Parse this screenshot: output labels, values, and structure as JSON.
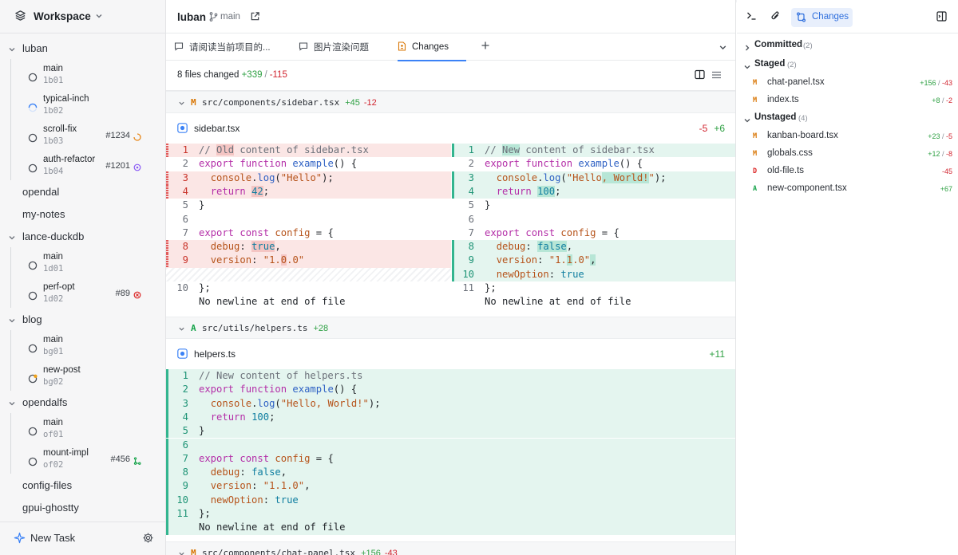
{
  "workspace": {
    "title": "Workspace"
  },
  "sidebar": {
    "projects": [
      {
        "name": "luban",
        "expanded": true,
        "branches": [
          {
            "name": "main",
            "id": "1b01",
            "pr": "",
            "status": "circle"
          },
          {
            "name": "typical-inch",
            "id": "1b02",
            "pr": "",
            "status": "spinner"
          },
          {
            "name": "scroll-fix",
            "id": "1b03",
            "pr": "#1234",
            "status": "circle",
            "pr_status": "pending"
          },
          {
            "name": "auth-refactor",
            "id": "1b04",
            "pr": "#1201",
            "status": "circle",
            "pr_status": "open"
          }
        ]
      },
      {
        "name": "opendal",
        "expanded": false,
        "branches": []
      },
      {
        "name": "my-notes",
        "expanded": false,
        "branches": []
      },
      {
        "name": "lance-duckdb",
        "expanded": true,
        "branches": [
          {
            "name": "main",
            "id": "1d01",
            "pr": "",
            "status": "circle"
          },
          {
            "name": "perf-opt",
            "id": "1d02",
            "pr": "#89",
            "status": "circle",
            "pr_status": "failed"
          }
        ]
      },
      {
        "name": "blog",
        "expanded": true,
        "branches": [
          {
            "name": "main",
            "id": "bg01",
            "pr": "",
            "status": "circle"
          },
          {
            "name": "new-post",
            "id": "bg02",
            "pr": "",
            "status": "draft"
          }
        ]
      },
      {
        "name": "opendalfs",
        "expanded": true,
        "branches": [
          {
            "name": "main",
            "id": "of01",
            "pr": "",
            "status": "circle"
          },
          {
            "name": "mount-impl",
            "id": "of02",
            "pr": "#456",
            "status": "circle",
            "pr_status": "merged"
          }
        ]
      },
      {
        "name": "config-files",
        "expanded": false,
        "branches": []
      },
      {
        "name": "gpui-ghostty",
        "expanded": false,
        "branches": []
      }
    ],
    "footer": {
      "new_task": "New Task"
    }
  },
  "main": {
    "repo": "luban",
    "branch": "main",
    "tabs": [
      {
        "label": "请阅读当前项目的...",
        "icon": "chat-icon",
        "active": false
      },
      {
        "label": "图片渲染问题",
        "icon": "chat-icon",
        "active": false
      },
      {
        "label": "Changes",
        "icon": "file-diff-icon",
        "active": true
      }
    ],
    "summary": {
      "text": "8 files changed",
      "additions": "+339",
      "separator": "/",
      "deletions": "-115"
    },
    "files": [
      {
        "status": "M",
        "path": "src/components/sidebar.tsx",
        "additions": "+45",
        "deletions": "-12",
        "name": "sidebar.tsx",
        "num_del": "-5",
        "num_add": "+6",
        "footer": "No newline at end of file"
      },
      {
        "status": "A",
        "path": "src/utils/helpers.ts",
        "additions": "+28",
        "deletions": "",
        "name": "helpers.ts",
        "num_del": "",
        "num_add": "+11",
        "footer": "No newline at end of file"
      },
      {
        "status": "M",
        "path": "src/components/chat-panel.tsx",
        "additions": "+156",
        "deletions": "-43"
      }
    ]
  },
  "right": {
    "changes_label": "Changes",
    "sections": [
      {
        "title": "Committed",
        "count": "(2)",
        "expanded": false,
        "items": []
      },
      {
        "title": "Staged",
        "count": "(2)",
        "expanded": true,
        "items": [
          {
            "status": "M",
            "file": "chat-panel.tsx",
            "additions": "+156",
            "deletions": "-43"
          },
          {
            "status": "M",
            "file": "index.ts",
            "additions": "+8",
            "deletions": "-2"
          }
        ]
      },
      {
        "title": "Unstaged",
        "count": "(4)",
        "expanded": true,
        "items": [
          {
            "status": "M",
            "file": "kanban-board.tsx",
            "additions": "+23",
            "deletions": "-5"
          },
          {
            "status": "M",
            "file": "globals.css",
            "additions": "+12",
            "deletions": "-8"
          },
          {
            "status": "D",
            "file": "old-file.ts",
            "additions": "",
            "deletions": "-45"
          },
          {
            "status": "A",
            "file": "new-component.tsx",
            "additions": "+67",
            "deletions": ""
          }
        ]
      }
    ]
  },
  "colors": {
    "accent": "#3b82f6",
    "added": "#2ea043",
    "deleted": "#d1242f",
    "modified": "#d97706"
  }
}
